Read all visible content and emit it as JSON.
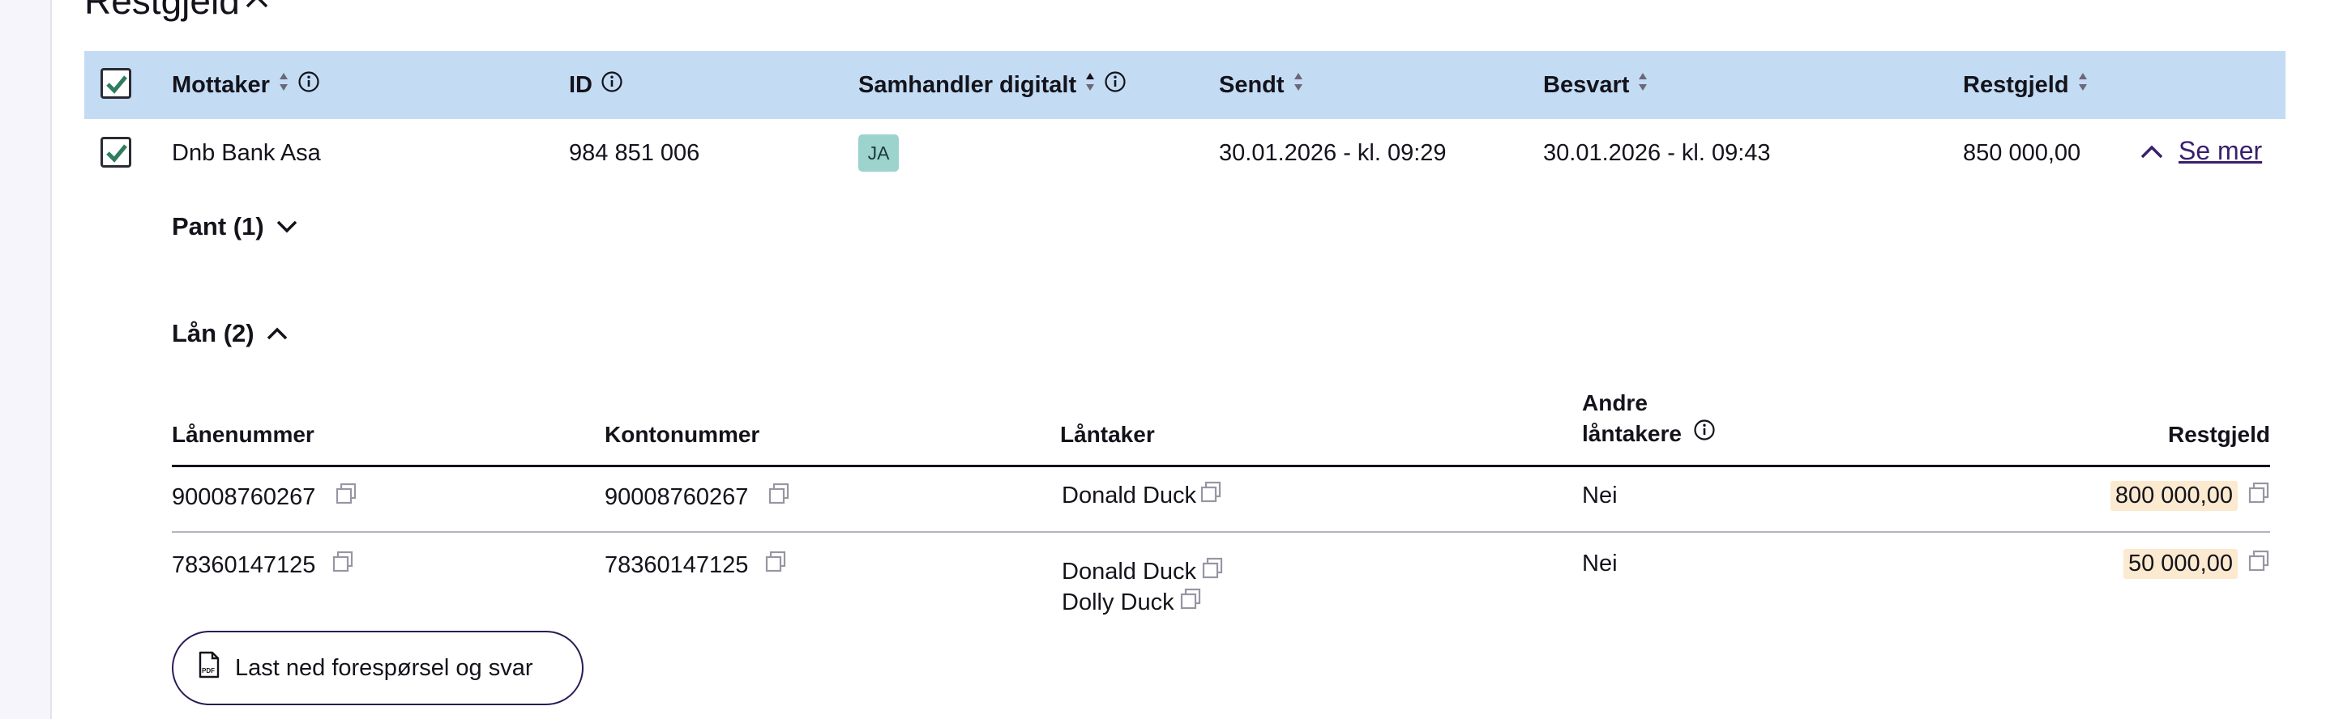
{
  "section": {
    "title": "Restgjeld"
  },
  "header": {
    "columns": {
      "mottaker": "Mottaker",
      "id": "ID",
      "samhandler": "Samhandler digitalt",
      "sendt": "Sendt",
      "besvart": "Besvart",
      "restgjeld": "Restgjeld"
    },
    "select_all_checked": true
  },
  "row": {
    "checked": true,
    "mottaker": "Dnb Bank Asa",
    "id": "984 851 006",
    "samhandler_badge": "JA",
    "sendt": "30.01.2026 - kl. 09:29",
    "besvart": "30.01.2026 - kl. 09:43",
    "restgjeld": "850 000,00",
    "toggle_label": "Se mer"
  },
  "pant": {
    "label": "Pant (1)"
  },
  "laan": {
    "label": "Lån (2)",
    "columns": {
      "laanenummer": "Lånenummer",
      "kontonummer": "Kontonummer",
      "laantaker": "Låntaker",
      "andre_line1": "Andre",
      "andre_line2": "låntakere",
      "restgjeld": "Restgjeld"
    },
    "rows": [
      {
        "laanenummer": "90008760267",
        "kontonummer": "90008760267",
        "laantakere": [
          "Donald Duck"
        ],
        "andre": "Nei",
        "restgjeld": "800 000,00"
      },
      {
        "laanenummer": "78360147125",
        "kontonummer": "78360147125",
        "laantakere": [
          "Donald Duck",
          "Dolly Duck"
        ],
        "andre": "Nei",
        "restgjeld": "50 000,00"
      }
    ]
  },
  "download_button": {
    "label": "Last ned forespørsel og svar",
    "icon": "pdf-file-icon"
  },
  "colors": {
    "header_bg": "#c3dcf4",
    "badge_bg": "#9dd3cd",
    "amount_highlight": "#fbead0",
    "link": "#3a1f6e"
  }
}
